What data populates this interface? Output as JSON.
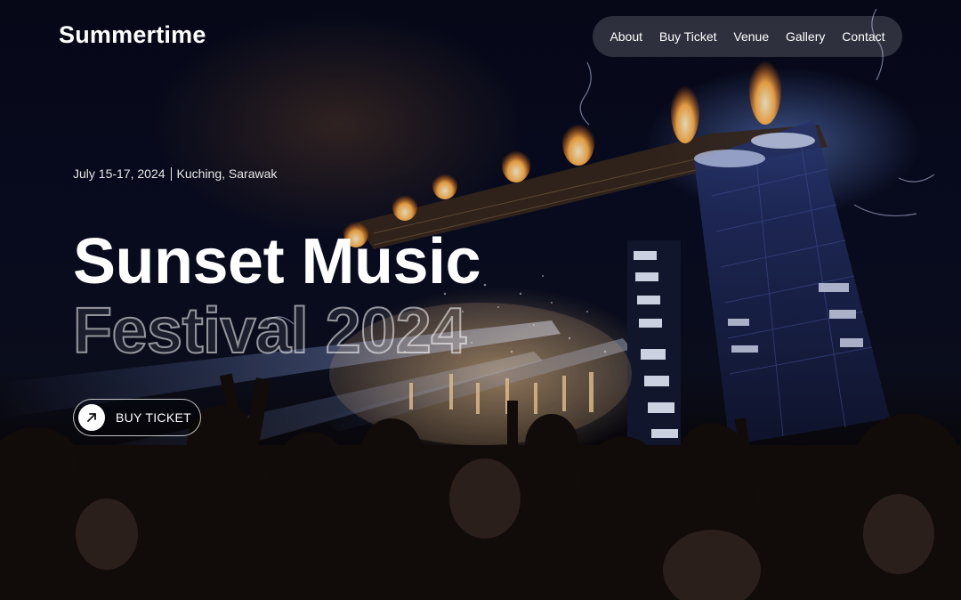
{
  "header": {
    "logo": "Summertime",
    "nav": [
      "About",
      "Buy Ticket",
      "Venue",
      "Gallery",
      "Contact"
    ]
  },
  "hero": {
    "date": "July 15-17, 2024",
    "location": "Kuching, Sarawak",
    "title_line1": "Sunset Music",
    "title_line2": "Festival 2024",
    "cta_label": "BUY TICKET",
    "cta_icon": "arrow-up-right-icon",
    "background_image": "festival-crowd-stage-photo"
  },
  "colors": {
    "text": "#ffffff",
    "nav_bg": "rgba(255,255,255,0.16)",
    "stage_warm": "#ffb060",
    "stage_blue": "#6e8cff"
  }
}
